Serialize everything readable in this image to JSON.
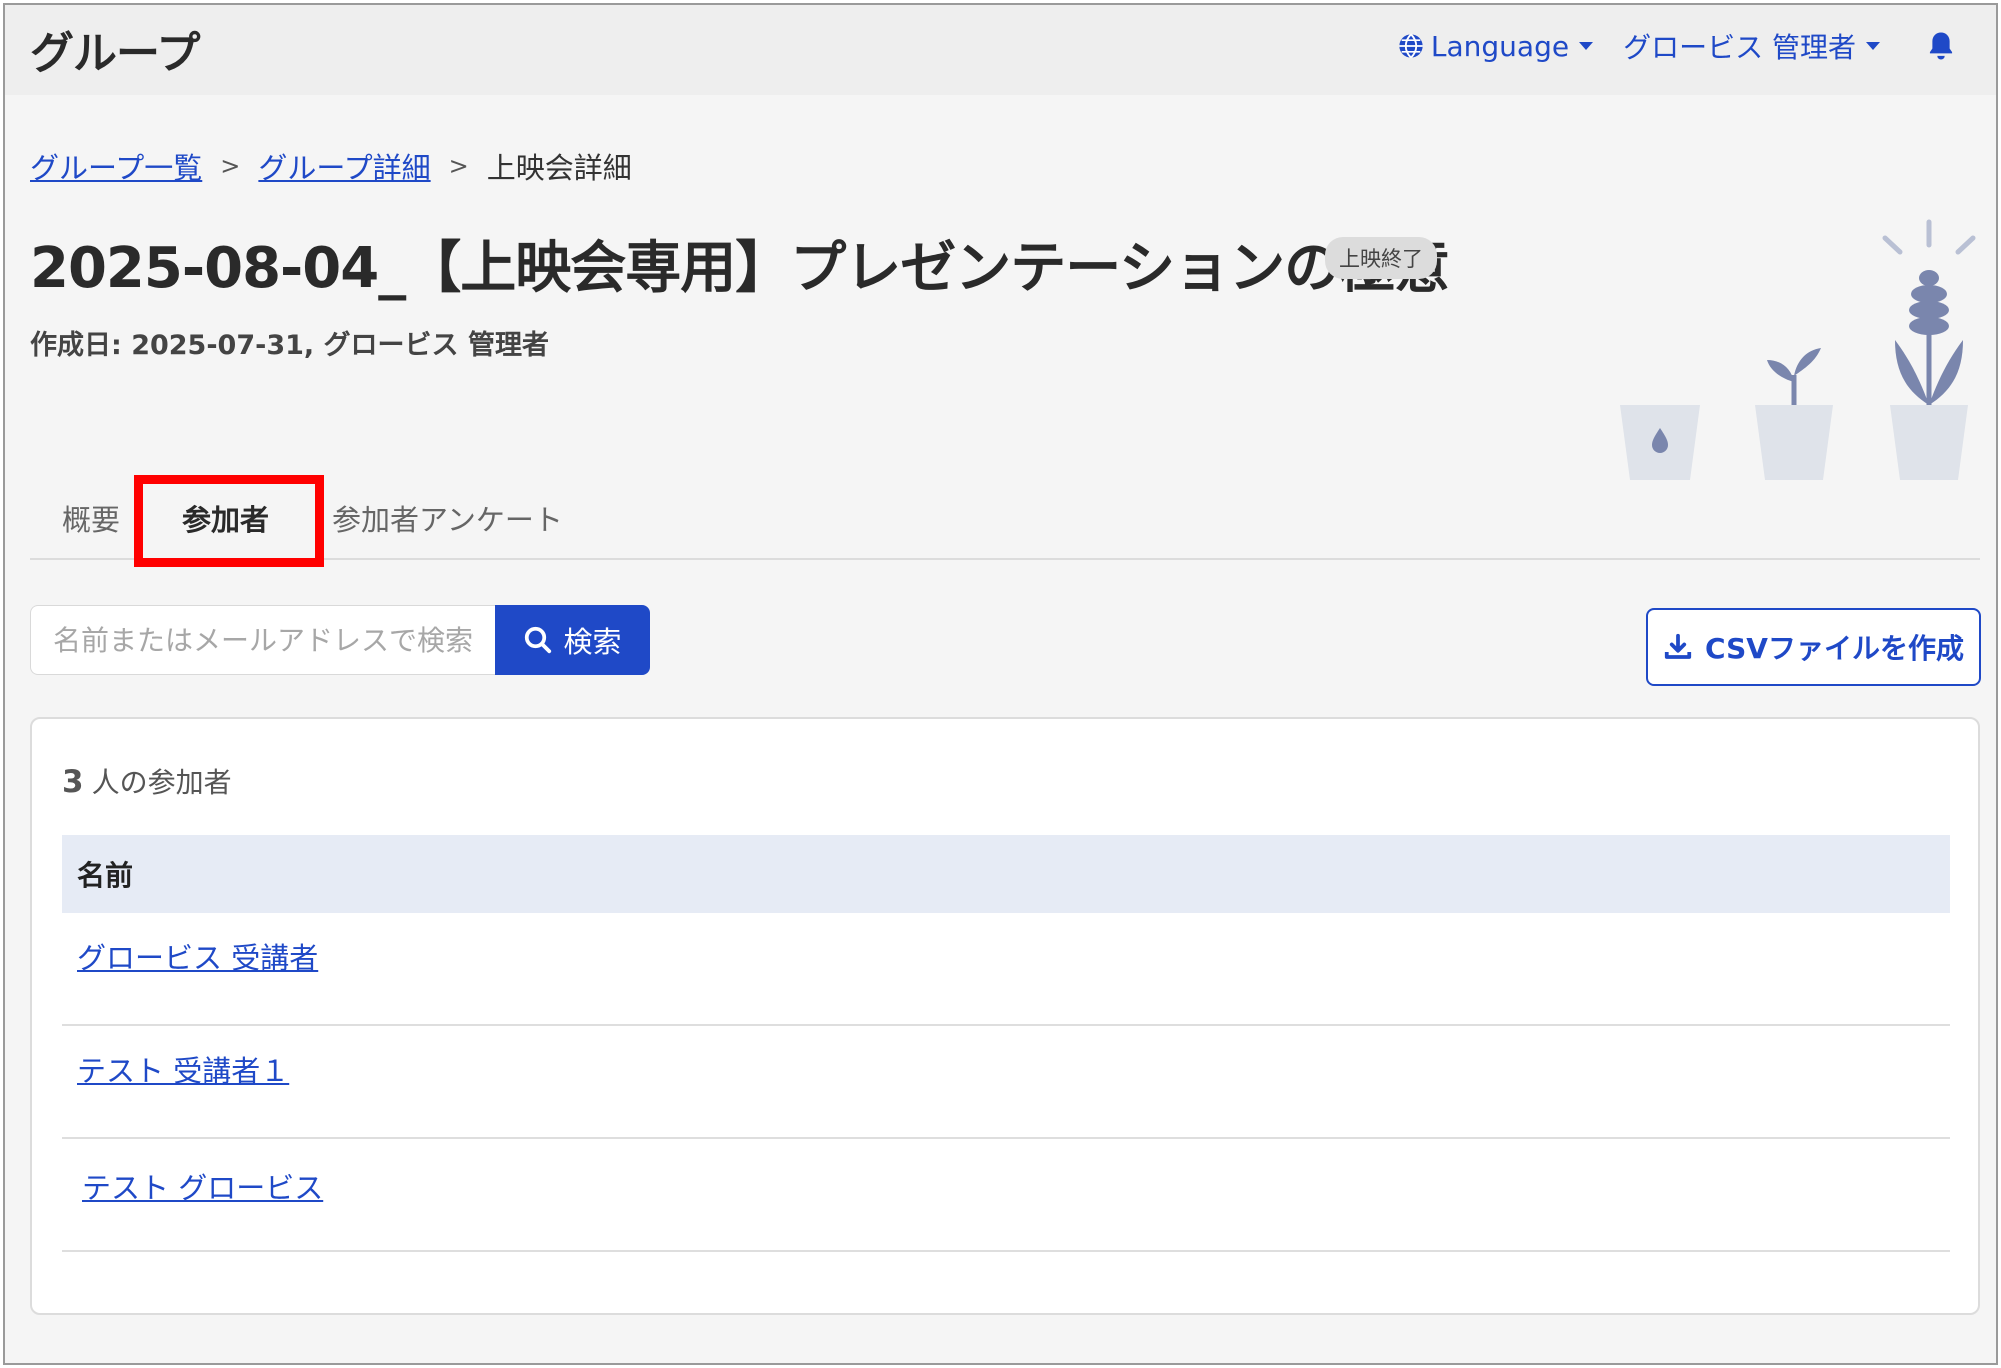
{
  "header": {
    "app_title": "グループ",
    "language_label": "Language",
    "user_label": "グロービス 管理者"
  },
  "breadcrumb": {
    "items": [
      "グループ一覧",
      "グループ詳細",
      "上映会詳細"
    ],
    "separator": ">"
  },
  "page": {
    "title": "2025-08-04_【上映会専用】プレゼンテーションの極意",
    "status_badge": "上映終了",
    "meta": "作成日: 2025-07-31, グロービス 管理者"
  },
  "tabs": [
    {
      "label": "概要",
      "active": false
    },
    {
      "label": "参加者",
      "active": true
    },
    {
      "label": "参加者アンケート",
      "active": false
    }
  ],
  "search": {
    "placeholder": "名前またはメールアドレスで検索",
    "button_label": "検索"
  },
  "csv_button_label": "CSVファイルを作成",
  "participants": {
    "count": "3",
    "count_label": "人の参加者",
    "column_header": "名前",
    "rows": [
      "グロービス 受講者",
      "テスト 受講者１",
      "テスト グロービス"
    ]
  },
  "colors": {
    "accent": "#1f49c7",
    "highlight": "#ff0000",
    "table_header_bg": "#e6ebf5"
  }
}
